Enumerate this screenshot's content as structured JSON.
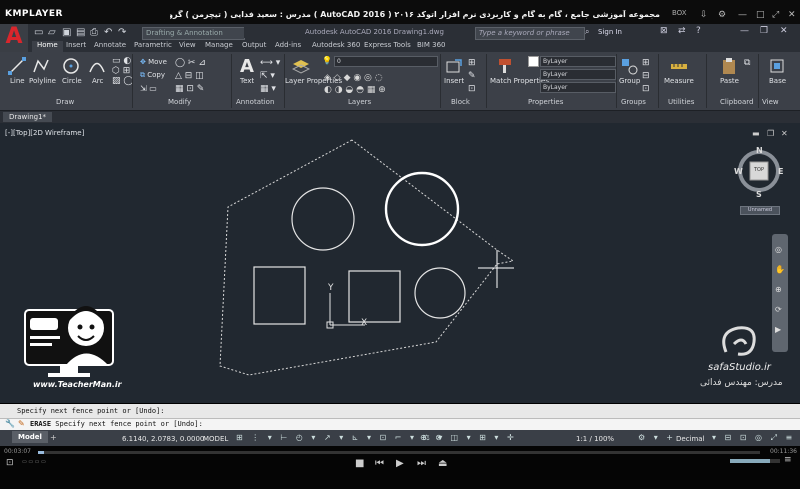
{
  "player": {
    "logo": "KMPLAYER",
    "title": "مجموعه آموزشی جامع ، گام به گام و کاربردی نرم افزار اتوکد ۲۰۱۶ ( AutoCAD 2016 ) مدرس : سعید فدایی ( تیچرمن ) گروه آموزشی پادشاه گرافیست ها",
    "time_elapsed": "00:03:07",
    "time_total": "00:11:36",
    "box_label": "BOX"
  },
  "acad": {
    "logo": "A",
    "workspace": "Drafting & Annotation",
    "title": "Autodesk AutoCAD 2016   Drawing1.dwg",
    "search_placeholder": "Type a keyword or phrase",
    "signin": "Sign In"
  },
  "tabs": [
    "Home",
    "Insert",
    "Annotate",
    "Parametric",
    "View",
    "Manage",
    "Output",
    "Add-ins",
    "Autodesk 360",
    "Express Tools",
    "BIM 360"
  ],
  "ribbon": {
    "draw": {
      "title": "Draw",
      "tools": [
        "Line",
        "Polyline",
        "Circle",
        "Arc"
      ]
    },
    "modify": {
      "title": "Modify",
      "tools": [
        "Move",
        "Copy"
      ]
    },
    "annotation": {
      "title": "Annotation",
      "tools": [
        "Text"
      ]
    },
    "layers": {
      "title": "Layers",
      "tool": "Layer Properties",
      "layer_value": "0"
    },
    "block": {
      "title": "Block",
      "tool": "Insert"
    },
    "properties": {
      "title": "Properties",
      "tool": "Match Properties",
      "color": "ByLayer",
      "linetype": "ByLayer",
      "lineweight": "ByLayer"
    },
    "groups": {
      "title": "Groups",
      "tool": "Group"
    },
    "utilities": {
      "title": "Utilities",
      "tool": "Measure"
    },
    "clipboard": {
      "title": "Clipboard",
      "tool": "Paste"
    },
    "view": {
      "title": "View",
      "tool": "Base"
    }
  },
  "document": {
    "tab": "Drawing1*",
    "view_label": "[-][Top][2D Wireframe]"
  },
  "viewcube": {
    "top": "TOP",
    "n": "N",
    "s": "S",
    "e": "E",
    "w": "W",
    "ucs": "Unnamed"
  },
  "command": {
    "history": "Specify next fence point or [Undo]:",
    "prefix": "ERASE",
    "current": "Specify next fence point or [Undo]:"
  },
  "status": {
    "model_tab": "Model",
    "coords": "6.1140, 2.0783, 0.0000",
    "model_btn": "MODEL",
    "scale": "1:1 / 100%",
    "units": "Decimal"
  },
  "overlay": {
    "teacher_url": "www.TeacherMan.ir",
    "safa_url": "safaStudio.ir",
    "safa_credit": "مدرس: مهندس فدائی"
  },
  "colors": {
    "canvas": "#212830",
    "ribbon": "#3c4048",
    "accent_red": "#d9262c"
  }
}
